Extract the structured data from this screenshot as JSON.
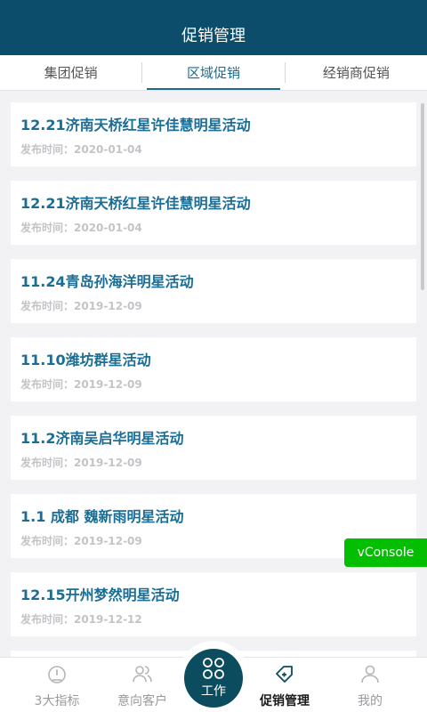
{
  "header": {
    "title": "促销管理"
  },
  "tabs": [
    {
      "label": "集团促销",
      "active": false
    },
    {
      "label": "区域促销",
      "active": true
    },
    {
      "label": "经销商促销",
      "active": false
    }
  ],
  "promotions": [
    {
      "title": "12.21济南天桥红星许佳慧明星活动",
      "date": "发布时间：2020-01-04"
    },
    {
      "title": "12.21济南天桥红星许佳慧明星活动",
      "date": "发布时间：2020-01-04"
    },
    {
      "title": "11.24青岛孙海洋明星活动",
      "date": "发布时间：2019-12-09"
    },
    {
      "title": "11.10潍坊群星活动",
      "date": "发布时间：2019-12-09"
    },
    {
      "title": "11.2济南吴启华明星活动",
      "date": "发布时间：2019-12-09"
    },
    {
      "title": "1.1 成都 魏新雨明星活动",
      "date": "发布时间：2019-12-09"
    },
    {
      "title": "12.15开州梦然明星活动",
      "date": "发布时间：2019-12-12"
    }
  ],
  "vconsole": {
    "label": "vConsole"
  },
  "tabbar": {
    "items": [
      {
        "label": "3大指标",
        "icon": "gauge-icon"
      },
      {
        "label": "意向客户",
        "icon": "customers-icon"
      },
      {
        "label": "工作",
        "icon": "grid-icon"
      },
      {
        "label": "促销管理",
        "icon": "tag-icon"
      },
      {
        "label": "我的",
        "icon": "person-icon"
      }
    ],
    "active_index": 3
  },
  "colors": {
    "header_bg": "#0b4d6b",
    "accent": "#1a6d94",
    "center_button": "#0b4d5f",
    "vconsole": "#04be02"
  }
}
